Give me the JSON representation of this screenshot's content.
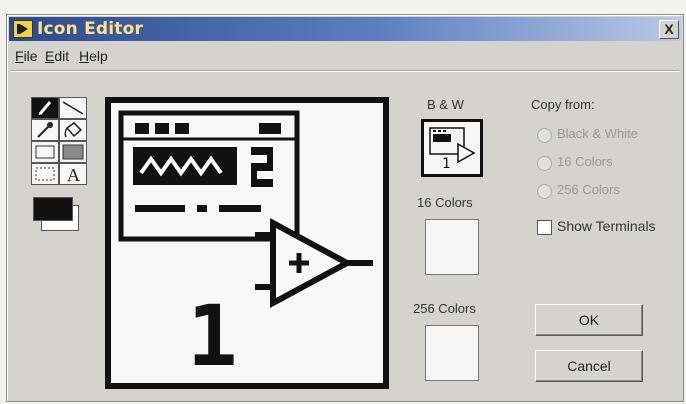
{
  "window": {
    "title": "Icon Editor",
    "close_label": "X"
  },
  "menu": {
    "items": [
      {
        "label": "File",
        "accel": "F",
        "rest": "ile"
      },
      {
        "label": "Edit",
        "accel": "E",
        "rest": "dit"
      },
      {
        "label": "Help",
        "accel": "H",
        "rest": "elp"
      }
    ]
  },
  "tools": [
    {
      "name": "pencil-tool",
      "icon": "pencil-icon",
      "selected": true
    },
    {
      "name": "line-tool",
      "icon": "line-icon",
      "selected": false
    },
    {
      "name": "dropper-tool",
      "icon": "dropper-icon",
      "selected": false
    },
    {
      "name": "fill-tool",
      "icon": "paint-bucket-icon",
      "selected": false
    },
    {
      "name": "rectangle-tool",
      "icon": "rectangle-icon",
      "selected": false
    },
    {
      "name": "filled-rectangle-tool",
      "icon": "filled-rectangle-icon",
      "selected": false
    },
    {
      "name": "select-tool",
      "icon": "marquee-icon",
      "selected": false
    },
    {
      "name": "text-tool",
      "icon": "text-A-icon",
      "selected": false
    }
  ],
  "colors": {
    "foreground": "#111111",
    "background": "#ffffff"
  },
  "canvas": {
    "terminal_number": "1"
  },
  "icon_sets": {
    "bw_label": "B & W",
    "c16_label": "16 Colors",
    "c256_label": "256 Colors",
    "bw_icon_number": "1"
  },
  "copy_from": {
    "label": "Copy from:",
    "options": [
      {
        "label": "Black & White",
        "enabled": false
      },
      {
        "label": "16 Colors",
        "enabled": false
      },
      {
        "label": "256 Colors",
        "enabled": false
      }
    ]
  },
  "show_terminals": {
    "label": "Show Terminals",
    "checked": false
  },
  "buttons": {
    "ok": "OK",
    "cancel": "Cancel"
  }
}
